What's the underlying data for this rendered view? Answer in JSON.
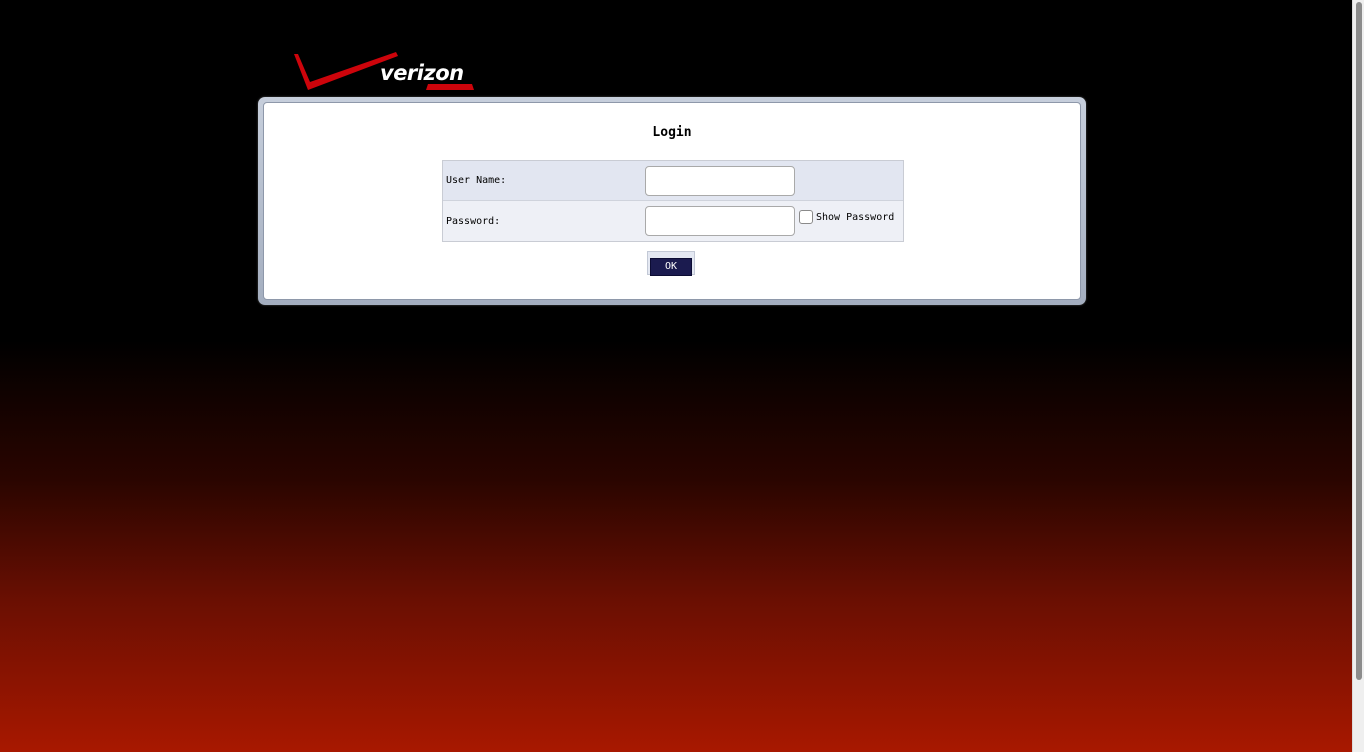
{
  "brand": {
    "logo_text": "verizon",
    "accent_color": "#cd040b"
  },
  "login": {
    "title": "Login",
    "username": {
      "label": "User Name:",
      "value": "",
      "placeholder": ""
    },
    "password": {
      "label": "Password:",
      "value": "",
      "placeholder": ""
    },
    "show_password": {
      "label": "Show Password",
      "checked": false
    },
    "ok_label": "OK"
  },
  "colors": {
    "background_top": "#000000",
    "background_bottom": "#a81800",
    "button": "#1b1b4f"
  }
}
